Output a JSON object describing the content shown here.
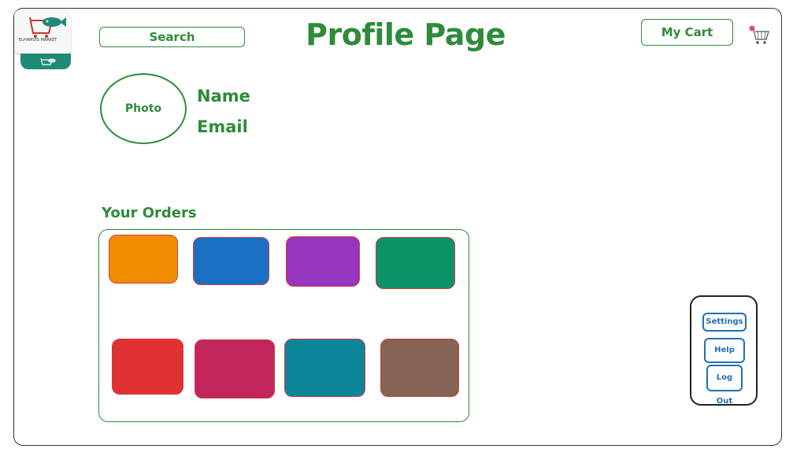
{
  "header": {
    "search_label": "Search",
    "title": "Profile Page",
    "cart_label": "My Cart",
    "logo_text": "ELHAMOIS MARKET"
  },
  "profile": {
    "photo_label": "Photo",
    "name_label": "Name",
    "email_label": "Email"
  },
  "orders": {
    "title": "Your Orders",
    "tiles": [
      "#f08c00",
      "#1b6fc2",
      "#9635bd",
      "#0c9269",
      "#e03232",
      "#c2255c",
      "#0c8599",
      "#856355"
    ]
  },
  "side_menu": {
    "settings_label": "Settings",
    "help_label": "Help",
    "logout_label": "Log Out"
  },
  "colors": {
    "accent": "#2e8b3a",
    "menu_blue": "#1f6fb5"
  }
}
